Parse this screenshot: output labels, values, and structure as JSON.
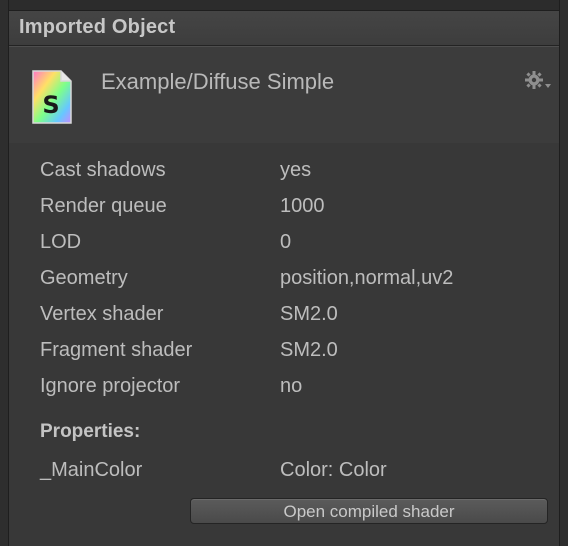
{
  "panel": {
    "title": "Imported Object"
  },
  "header": {
    "shader_name": "Example/Diffuse Simple",
    "icon_letter": "S",
    "icon": "shader-file-icon",
    "settings_icon": "gear-icon"
  },
  "properties": {
    "rows": [
      {
        "label": "Cast shadows",
        "value": "yes"
      },
      {
        "label": "Render queue",
        "value": "1000"
      },
      {
        "label": "LOD",
        "value": "0"
      },
      {
        "label": "Geometry",
        "value": "position,normal,uv2"
      },
      {
        "label": "Vertex shader",
        "value": "SM2.0"
      },
      {
        "label": "Fragment shader",
        "value": "SM2.0"
      },
      {
        "label": "Ignore projector",
        "value": "no"
      }
    ],
    "heading": "Properties:",
    "shader_props": [
      {
        "label": "_MainColor",
        "value": "Color: Color"
      }
    ]
  },
  "actions": {
    "open_compiled_label": "Open compiled shader"
  },
  "colors": {
    "background": "#383838",
    "text": "#bdbdbd",
    "button": "#525252"
  }
}
